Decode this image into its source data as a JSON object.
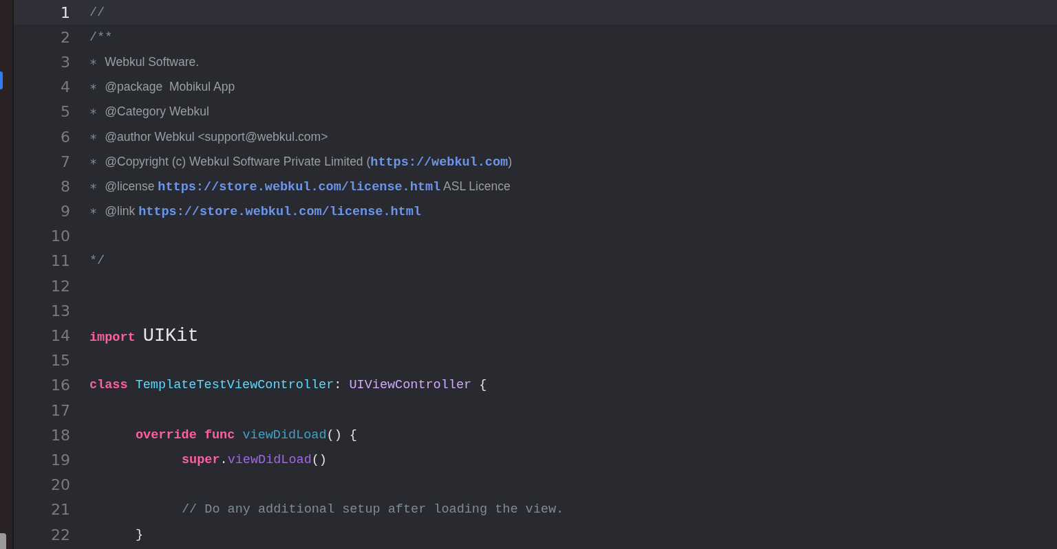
{
  "editor": {
    "lines": [
      {
        "number": "1",
        "current": true,
        "tokens": [
          {
            "kind": "comment",
            "text": "//"
          }
        ]
      },
      {
        "number": "2",
        "current": false,
        "tokens": [
          {
            "kind": "comment",
            "text": "/**"
          }
        ]
      },
      {
        "number": "3",
        "current": false,
        "tokens": [
          {
            "kind": "comment",
            "text": "∗ "
          },
          {
            "kind": "doc",
            "text": "Webkul Software."
          }
        ]
      },
      {
        "number": "4",
        "current": false,
        "tokens": [
          {
            "kind": "comment",
            "text": "∗ "
          },
          {
            "kind": "doc",
            "text": "@package  Mobikul App"
          }
        ]
      },
      {
        "number": "5",
        "current": false,
        "tokens": [
          {
            "kind": "comment",
            "text": "∗ "
          },
          {
            "kind": "doc",
            "text": "@Category Webkul"
          }
        ]
      },
      {
        "number": "6",
        "current": false,
        "tokens": [
          {
            "kind": "comment",
            "text": "∗ "
          },
          {
            "kind": "doc",
            "text": "@author Webkul <support@webkul.com>"
          }
        ]
      },
      {
        "number": "7",
        "current": false,
        "tokens": [
          {
            "kind": "comment",
            "text": "∗ "
          },
          {
            "kind": "doc",
            "text": "@Copyright (c) Webkul Software Private Limited ("
          },
          {
            "kind": "link",
            "text": "https://webkul.com"
          },
          {
            "kind": "doc",
            "text": ")"
          }
        ]
      },
      {
        "number": "8",
        "current": false,
        "tokens": [
          {
            "kind": "comment",
            "text": "∗ "
          },
          {
            "kind": "doc",
            "text": "@license "
          },
          {
            "kind": "link",
            "text": "https://store.webkul.com/license.html"
          },
          {
            "kind": "doc",
            "text": " ASL Licence"
          }
        ]
      },
      {
        "number": "9",
        "current": false,
        "tokens": [
          {
            "kind": "comment",
            "text": "∗ "
          },
          {
            "kind": "doc",
            "text": "@link "
          },
          {
            "kind": "link",
            "text": "https://store.webkul.com/license.html"
          }
        ]
      },
      {
        "number": "10",
        "current": false
      },
      {
        "number": "11",
        "current": false,
        "tokens": [
          {
            "kind": "comment",
            "text": "*/"
          }
        ]
      },
      {
        "number": "12",
        "current": false
      },
      {
        "number": "13",
        "current": false
      },
      {
        "number": "14",
        "current": false,
        "tokens": [
          {
            "kind": "keyword",
            "text": "import "
          },
          {
            "kind": "module",
            "text": "UIKit"
          }
        ]
      },
      {
        "number": "15",
        "current": false
      },
      {
        "number": "16",
        "current": false,
        "tokens": [
          {
            "kind": "keyword",
            "text": "class "
          },
          {
            "kind": "type_decl",
            "text": "TemplateTestViewController"
          },
          {
            "kind": "plain",
            "text": ": "
          },
          {
            "kind": "type_ref",
            "text": "UIViewController"
          },
          {
            "kind": "plain",
            "text": " {"
          }
        ],
        "children": [
          {
            "number": "17",
            "current": false
          },
          {
            "number": "18",
            "current": false,
            "tokens": [
              {
                "kind": "keyword",
                "text": "override func "
              },
              {
                "kind": "func_decl",
                "text": "viewDidLoad"
              },
              {
                "kind": "plain",
                "text": "() {"
              }
            ],
            "children": [
              {
                "number": "19",
                "current": false,
                "tokens": [
                  {
                    "kind": "keyword",
                    "text": "super"
                  },
                  {
                    "kind": "plain",
                    "text": "."
                  },
                  {
                    "kind": "func_call",
                    "text": "viewDidLoad"
                  },
                  {
                    "kind": "plain",
                    "text": "()"
                  }
                ]
              },
              {
                "number": "20",
                "current": false
              },
              {
                "number": "21",
                "current": false,
                "tokens": [
                  {
                    "kind": "comment",
                    "text": "// Do any additional setup after loading the view."
                  }
                ]
              }
            ]
          },
          {
            "number": "22",
            "current": false,
            "tokens": [
              {
                "kind": "plain",
                "text": "}"
              }
            ]
          }
        ]
      }
    ]
  }
}
